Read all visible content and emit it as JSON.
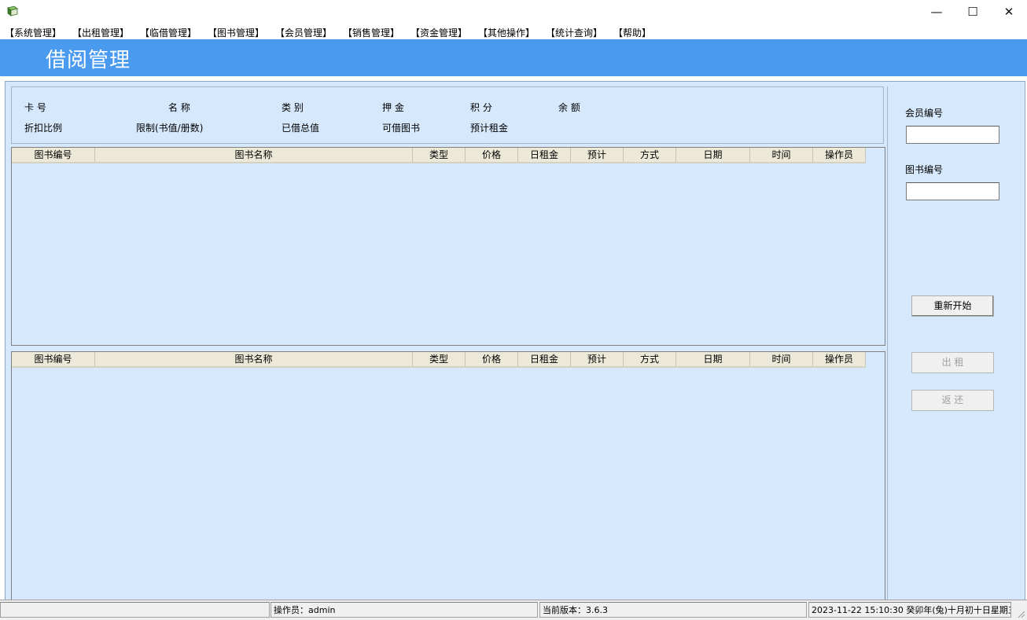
{
  "window": {
    "minimize_glyph": "—",
    "maximize_glyph": "☐",
    "close_glyph": "✕",
    "icon": "book-icon"
  },
  "menu": [
    "【系统管理】",
    "【出租管理】",
    "【临借管理】",
    "【图书管理】",
    "【会员管理】",
    "【销售管理】",
    "【资金管理】",
    "【其他操作】",
    "【统计查询】",
    "【帮助】"
  ],
  "banner": {
    "title": "借阅管理",
    "color": "#4a9bef"
  },
  "info": {
    "card_no": "卡    号",
    "name": "名    称",
    "category": "类    别",
    "deposit": "押    金",
    "points": "积 分",
    "balance": "余    额",
    "discount": "折扣比例",
    "limit": "限制(书值/册数)",
    "borrowed_total": "已借总值",
    "borrowable": "可借图书",
    "est_rent": "预计租金"
  },
  "grid_columns": [
    "图书编号",
    "图书名称",
    "类型",
    "价格",
    "日租金",
    "预计",
    "方式",
    "日期",
    "时间",
    "操作员"
  ],
  "side": {
    "member_no_label": "会员编号",
    "member_no_value": "",
    "book_no_label": "图书编号",
    "book_no_value": "",
    "restart_label": "重新开始",
    "rent_label": "出    租",
    "return_label": "返    还"
  },
  "status": {
    "cell1": "",
    "operator": "操作员：admin",
    "version": "当前版本：3.6.3",
    "datetime": "2023-11-22 15:10:30 癸卯年(兔)十月初十日星期三"
  }
}
